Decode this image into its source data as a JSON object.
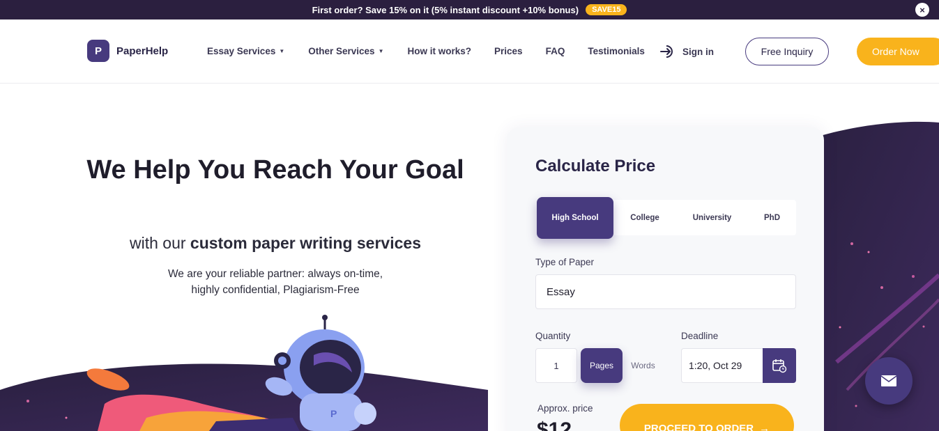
{
  "promo": {
    "text": "First order? Save 15% on it (5% instant discount +10% bonus)",
    "code": "SAVE15",
    "close": "×"
  },
  "header": {
    "logo_letter": "P",
    "logo_text": "PaperHelp",
    "nav": [
      {
        "label": "Essay Services",
        "dropdown": true
      },
      {
        "label": "Other Services",
        "dropdown": true
      },
      {
        "label": "How it works?",
        "dropdown": false
      },
      {
        "label": "Prices",
        "dropdown": false
      },
      {
        "label": "FAQ",
        "dropdown": false
      },
      {
        "label": "Testimonials",
        "dropdown": false
      }
    ],
    "signin": "Sign in",
    "inquiry": "Free Inquiry",
    "order": "Order Now"
  },
  "hero": {
    "title": "We Help You Reach Your Goal",
    "sub_prefix": "with our",
    "sub_bold": "custom paper writing services",
    "desc_line1": "We are your reliable partner: always on-time,",
    "desc_line2": "highly confidential, Plagiarism-Free"
  },
  "calculator": {
    "title": "Calculate Price",
    "levels": [
      "High School",
      "College",
      "University",
      "PhD"
    ],
    "active_level": "High School",
    "type_label": "Type of Paper",
    "type_value": "Essay",
    "quantity_label": "Quantity",
    "quantity_value": "1",
    "unit_pages": "Pages",
    "unit_words": "Words",
    "active_unit": "Pages",
    "deadline_label": "Deadline",
    "deadline_value": "1:20, Oct 29",
    "approx_label": "Approx. price",
    "price": "$12",
    "proceed": "PROCEED TO ORDER"
  },
  "colors": {
    "brand": "#473a7e",
    "accent": "#f9b31c",
    "dark": "#2b1f3f"
  },
  "icons": [
    "close-icon",
    "chevron-down-icon",
    "sign-in-icon",
    "calendar-icon",
    "arrow-right-icon",
    "envelope-icon"
  ]
}
